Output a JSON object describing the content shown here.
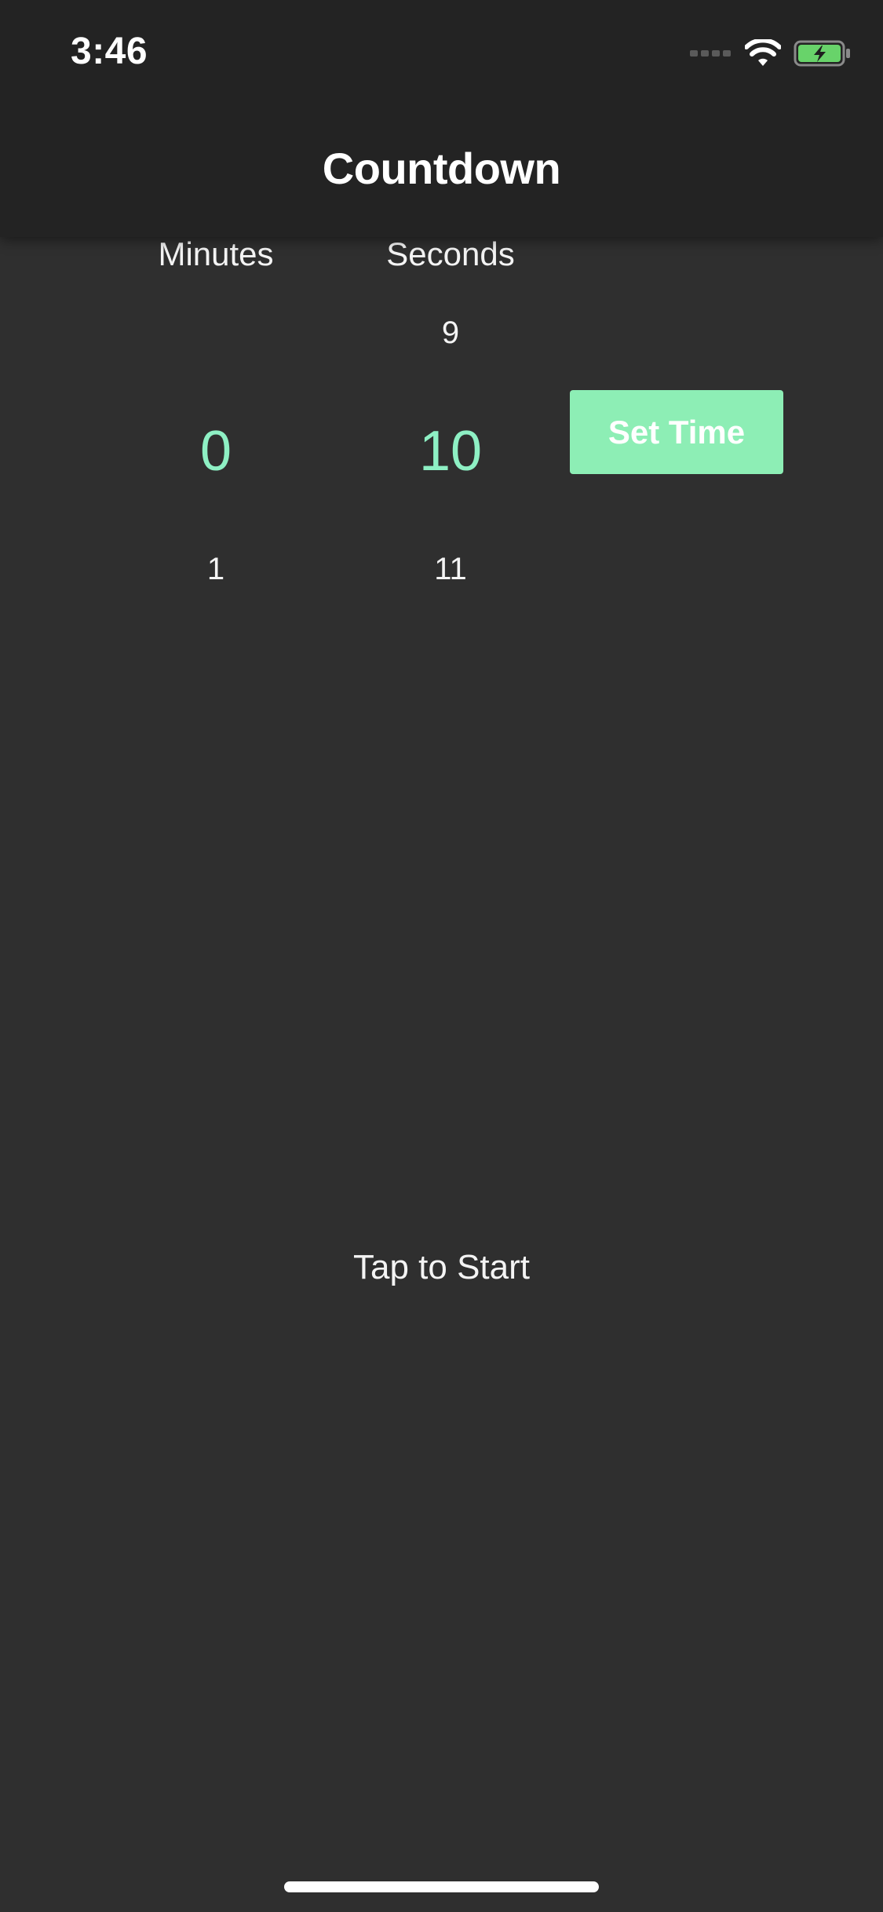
{
  "status_bar": {
    "time": "3:46",
    "icons": [
      "signal-icon",
      "wifi-icon",
      "battery-charging-icon"
    ]
  },
  "nav": {
    "title": "Countdown"
  },
  "picker": {
    "minutes": {
      "label": "Minutes",
      "selected": "0",
      "below": "1"
    },
    "seconds": {
      "label": "Seconds",
      "above": "9",
      "selected": "10",
      "below": "11"
    }
  },
  "actions": {
    "set_time_label": "Set Time",
    "tap_to_start_label": "Tap to Start"
  },
  "colors": {
    "background": "#2f2f2f",
    "header": "#232323",
    "accent_text": "#8ef0c4",
    "button": "#8deeb5",
    "battery_fill": "#68d36a"
  }
}
